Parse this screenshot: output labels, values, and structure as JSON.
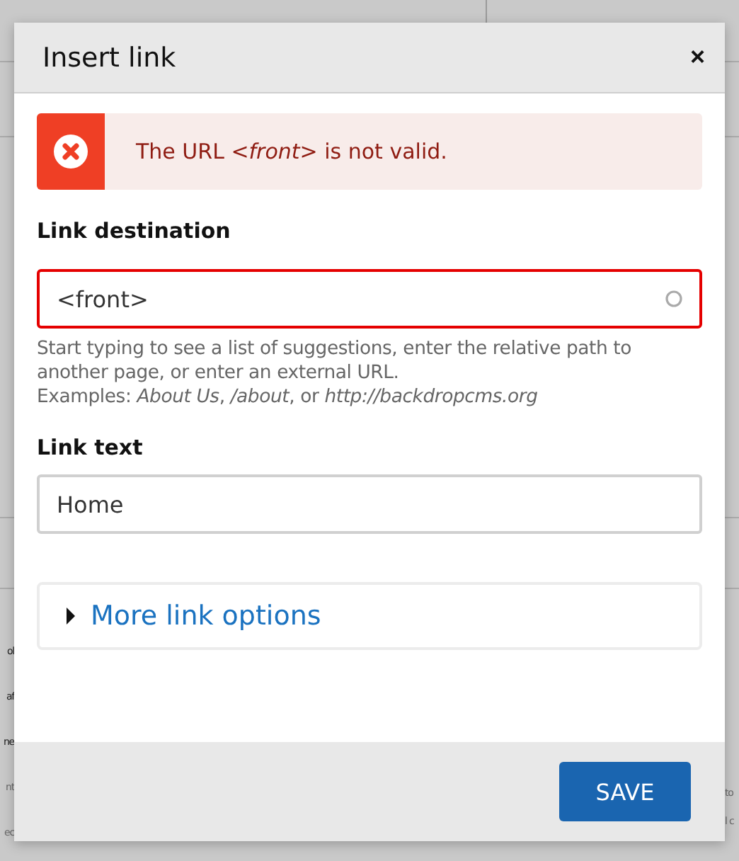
{
  "backdrop": {
    "left_fragments": [
      "ol",
      "af",
      "ne",
      "nt",
      "ec"
    ],
    "right_fragments": [
      "to",
      "l c"
    ]
  },
  "dialog": {
    "title": "Insert link",
    "close": "×",
    "error": {
      "message": "The URL *<front>* is not valid."
    },
    "fields": [
      {
        "kind": "autocomplete",
        "label": "Link destination",
        "value": "<front>",
        "invalid": true,
        "help": [
          "Start typing to see a list of suggestions, enter the relative path to another page, or enter an external URL.",
          "Examples: *About Us*, */about*, or *http://backdropcms.org*"
        ]
      },
      {
        "kind": "text",
        "label": "Link text",
        "value": "Home",
        "invalid": false
      }
    ],
    "details": {
      "summary": "More link options",
      "expanded": false
    },
    "buttons": [
      "SAVE"
    ]
  }
}
